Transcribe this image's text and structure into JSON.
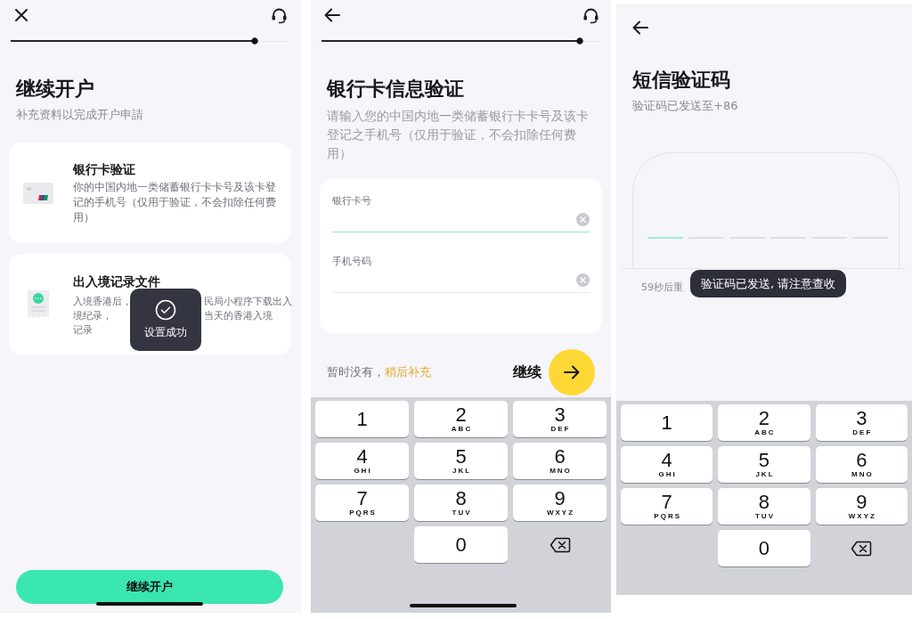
{
  "screens": [
    {
      "kind": "continue",
      "nav": {
        "kind": "close",
        "support": true
      },
      "progress": {
        "level": 0.89
      },
      "title": "继续开户",
      "subtitle": "补充资料以完成开户申請",
      "cards": [
        {
          "kind": "bank_card",
          "title": "银行卡验证",
          "description": "你的中国内地一类储蓄银行卡卡号及该卡登记的手机号（仅用于验证，不会扣除任何费用）"
        },
        {
          "kind": "document",
          "title": "出入境记录文件",
          "description_lines": [
            [
              "入境香港后，",
              "民局小程序下载出入"
            ],
            [
              "境纪录，",
              "当天的香港入境"
            ],
            [
              "记录"
            ]
          ]
        }
      ],
      "toast": {
        "text": "设置成功"
      },
      "button": "继续开户"
    },
    {
      "kind": "bank_form",
      "nav": {
        "kind": "back",
        "support": true
      },
      "progress": {
        "level": 0.94
      },
      "title": "银行卡信息验证",
      "description": "请输入您的中国内地一类储蓄银行卡卡号及该卡登记之手机号（仅用于验证，不会扣除任何费用）",
      "fields": [
        {
          "label": "银行卡号",
          "focused": true
        },
        {
          "label": "手机号码",
          "focused": false
        }
      ],
      "footer": {
        "note": "暂时没有，",
        "link": "稍后补充",
        "next": "继续"
      },
      "keypad": {
        "keys": [
          {
            "kind": "digit",
            "digit": "1"
          },
          {
            "kind": "digit",
            "digit": "2",
            "letters": "ABC"
          },
          {
            "kind": "digit",
            "digit": "3",
            "letters": "DEF"
          },
          {
            "kind": "digit",
            "digit": "4",
            "letters": "GHI"
          },
          {
            "kind": "digit",
            "digit": "5",
            "letters": "JKL"
          },
          {
            "kind": "digit",
            "digit": "6",
            "letters": "MNO"
          },
          {
            "kind": "digit",
            "digit": "7",
            "letters": "PQRS"
          },
          {
            "kind": "digit",
            "digit": "8",
            "letters": "TUV"
          },
          {
            "kind": "digit",
            "digit": "9",
            "letters": "WXYZ"
          },
          {
            "kind": "blank"
          },
          {
            "kind": "digit",
            "digit": "0"
          },
          {
            "kind": "delete"
          }
        ]
      }
    },
    {
      "kind": "sms",
      "nav": {
        "kind": "back",
        "support": false
      },
      "title": "短信验证码",
      "subtitle": "验证码已发送至+86",
      "code_slots": [
        {
          "selected": true
        },
        {
          "selected": false
        },
        {
          "selected": false
        },
        {
          "selected": false
        },
        {
          "selected": false
        },
        {
          "selected": false
        }
      ],
      "countdown": "59秒后重",
      "toast": {
        "text": "验证码已发送, 请注意查收"
      },
      "keypad": {
        "keys": [
          {
            "kind": "digit",
            "digit": "1"
          },
          {
            "kind": "digit",
            "digit": "2",
            "letters": "ABC"
          },
          {
            "kind": "digit",
            "digit": "3",
            "letters": "DEF"
          },
          {
            "kind": "digit",
            "digit": "4",
            "letters": "GHI"
          },
          {
            "kind": "digit",
            "digit": "5",
            "letters": "JKL"
          },
          {
            "kind": "digit",
            "digit": "6",
            "letters": "MNO"
          },
          {
            "kind": "digit",
            "digit": "7",
            "letters": "PQRS"
          },
          {
            "kind": "digit",
            "digit": "8",
            "letters": "TUV"
          },
          {
            "kind": "digit",
            "digit": "9",
            "letters": "WXYZ"
          },
          {
            "kind": "blank"
          },
          {
            "kind": "digit",
            "digit": "0"
          },
          {
            "kind": "delete"
          }
        ]
      }
    }
  ]
}
